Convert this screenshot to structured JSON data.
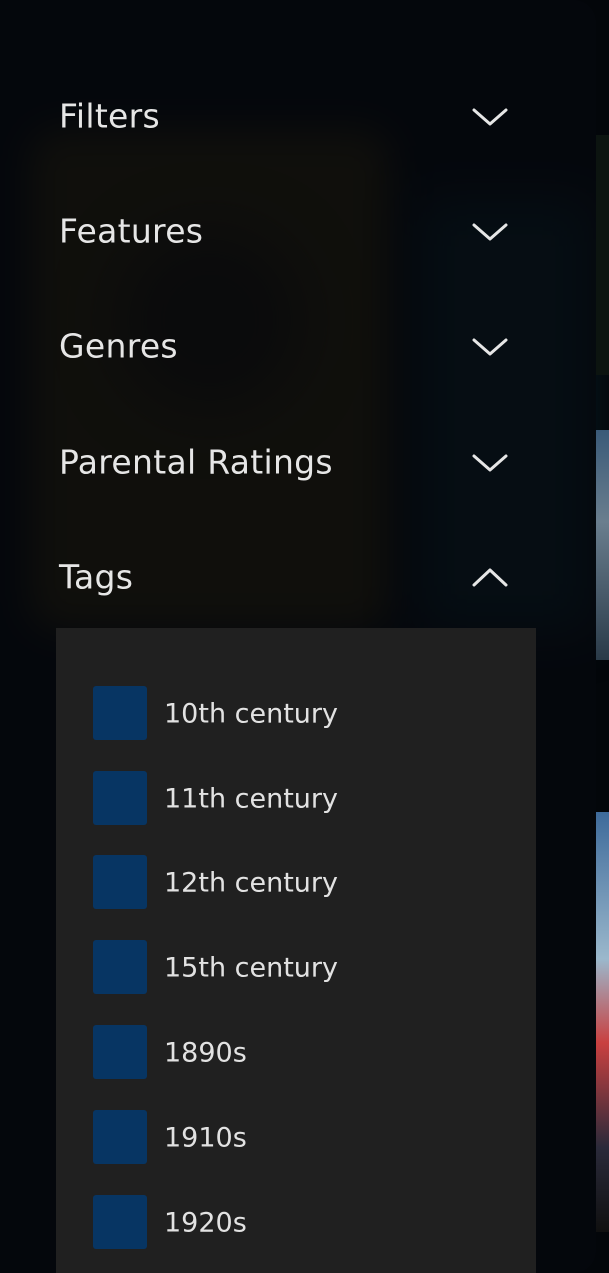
{
  "sections": [
    {
      "title": "Filters",
      "expanded": false,
      "icon": "chevron-down-icon"
    },
    {
      "title": "Features",
      "expanded": false,
      "icon": "chevron-down-icon"
    },
    {
      "title": "Genres",
      "expanded": false,
      "icon": "chevron-down-icon"
    },
    {
      "title": "Parental Ratings",
      "expanded": false,
      "icon": "chevron-down-icon"
    },
    {
      "title": "Tags",
      "expanded": true,
      "icon": "chevron-up-icon"
    }
  ],
  "tags": {
    "items": [
      {
        "label": "10th century",
        "checked": false
      },
      {
        "label": "11th century",
        "checked": false
      },
      {
        "label": "12th century",
        "checked": false
      },
      {
        "label": "15th century",
        "checked": false
      },
      {
        "label": "1890s",
        "checked": false
      },
      {
        "label": "1910s",
        "checked": false
      },
      {
        "label": "1920s",
        "checked": false
      }
    ]
  },
  "colors": {
    "panel_background": "#06090e",
    "tag_list_background": "#202020",
    "checkbox_fill": "#073563",
    "text": "#e6e6e6"
  }
}
